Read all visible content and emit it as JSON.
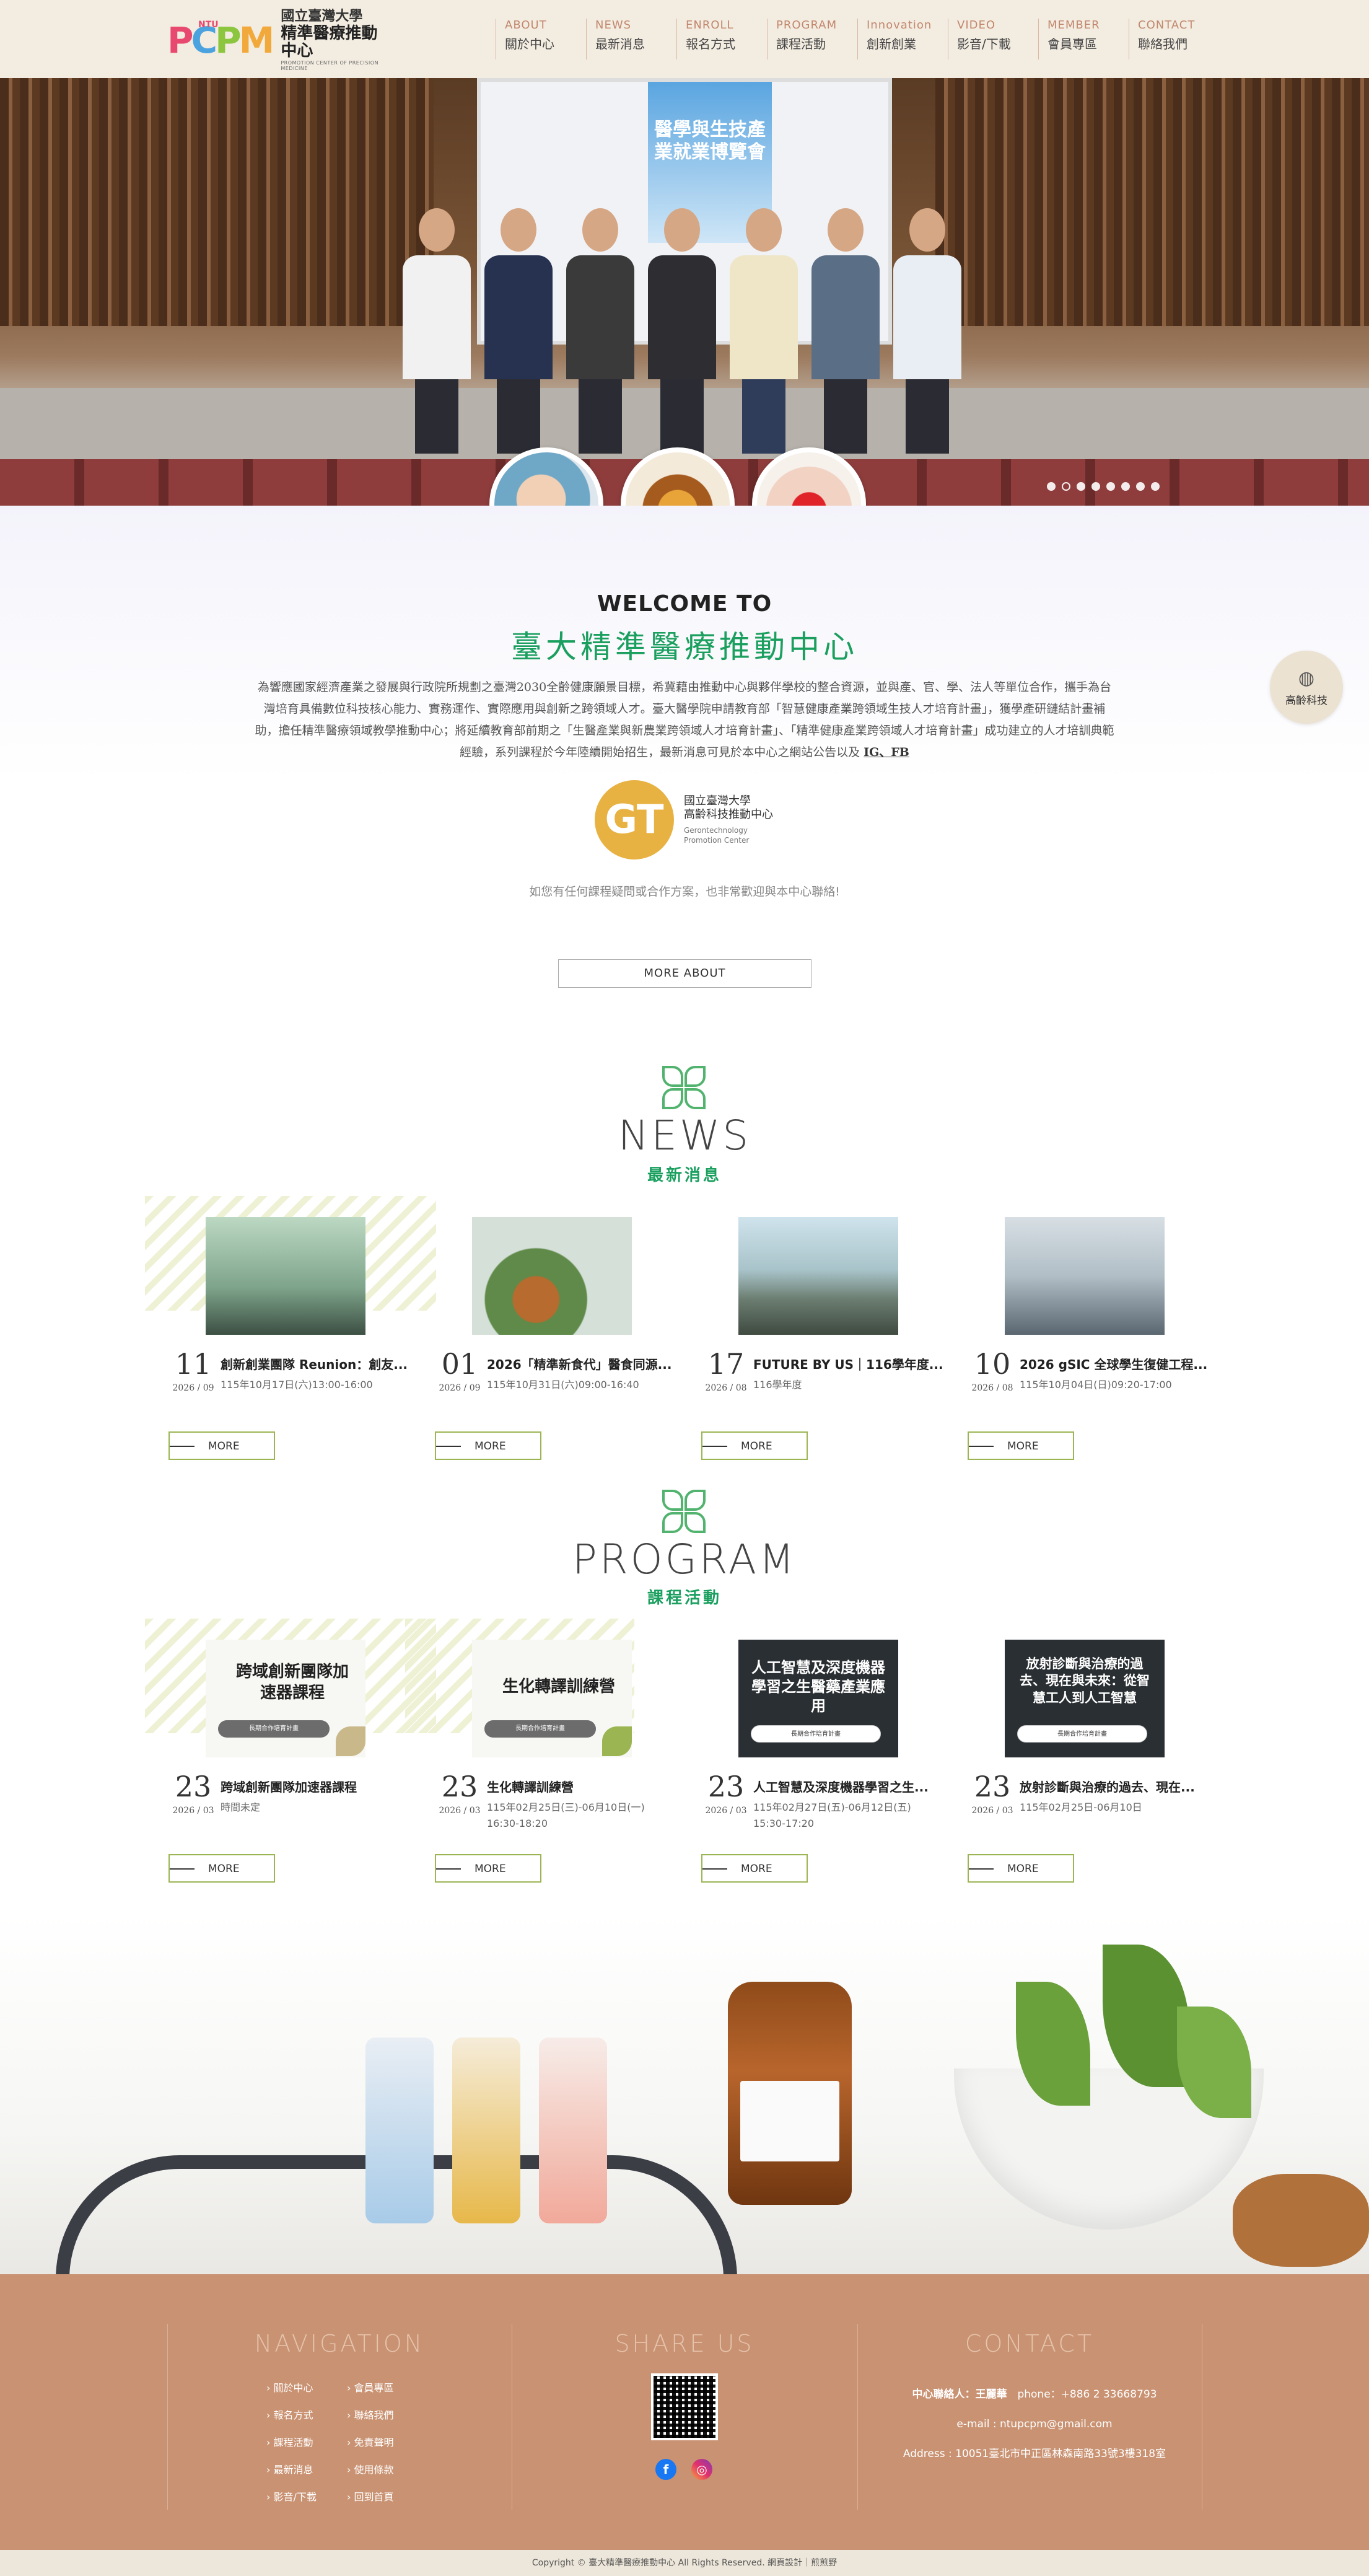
{
  "header": {
    "logo": {
      "badge": "NTU",
      "mark": "PCPM",
      "line1": "國立臺灣大學",
      "line2": "精準醫療推動中心",
      "line3": "PROMOTION CENTER OF PRECISION MEDICINE"
    },
    "nav": [
      {
        "en": "ABOUT",
        "zh": "關於中心"
      },
      {
        "en": "NEWS",
        "zh": "最新消息"
      },
      {
        "en": "ENROLL",
        "zh": "報名方式"
      },
      {
        "en": "PROGRAM",
        "zh": "課程活動"
      },
      {
        "en": "Innovation",
        "zh": "創新創業"
      },
      {
        "en": "VIDEO",
        "zh": "影音/下載"
      },
      {
        "en": "MEMBER",
        "zh": "會員專區"
      },
      {
        "en": "CONTACT",
        "zh": "聯絡我們"
      }
    ]
  },
  "hero": {
    "poster_title": "醫學與生技產業就業博覽會",
    "slides": 8,
    "active_slide": 2
  },
  "welcome": {
    "title_en": "WELCOME TO",
    "title_zh": "臺大精準醫療推動中心",
    "description": "為響應國家經濟產業之發展與行政院所規劃之臺灣2030全齡健康願景目標，希冀藉由推動中心與夥伴學校的整合資源，並與產、官、學、法人等單位合作，攜手為台灣培育具備數位科技核心能力、實務運作、實際應用與創新之跨領域人才。臺大醫學院申請教育部「智慧健康產業跨領域生技人才培育計畫」，獲學產研鏈結計畫補助，擔任精準醫療領域教學推動中心；將延續教育部前期之「生醫產業與新農業跨領域人才培育計畫」、「精準健康產業跨領域人才培育計畫」成功建立的人才培訓典範經驗，系列課程於今年陸續開始招生，最新消息可見於本中心之網站公告以及",
    "links": "IG、FB",
    "partner": {
      "mark": "GT",
      "line1": "國立臺灣大學",
      "line2": "高齡科技推動中心",
      "line3": "Gerontechnology",
      "line4": "Promotion Center"
    },
    "contact_note": "如您有任何課程疑問或合作方案，也非常歡迎與本中心聯絡!",
    "more_about": "MORE ABOUT"
  },
  "float": {
    "icon": "globe-icon",
    "label": "高齡科技"
  },
  "news": {
    "title": "NEWS",
    "subtitle": "最新消息",
    "items": [
      {
        "day": "11",
        "ym": "2026 / 09",
        "title": "創新創業團隊 Reunion：創友...",
        "meta": "115年10月17日(六)13:00-16:00",
        "more": "MORE"
      },
      {
        "day": "01",
        "ym": "2026 / 09",
        "title": "2026「精準新食代」醫食同源...",
        "meta": "115年10月31日(六)09:00-16:40",
        "more": "MORE"
      },
      {
        "day": "17",
        "ym": "2026 / 08",
        "title": "FUTURE BY US｜116學年度...",
        "meta": "116學年度",
        "more": "MORE"
      },
      {
        "day": "10",
        "ym": "2026 / 08",
        "title": "2026 gSIC 全球學生復健工程...",
        "meta": "115年10月04日(日)09:20-17:00",
        "more": "MORE"
      }
    ]
  },
  "program": {
    "title": "PROGRAM",
    "subtitle": "課程活動",
    "items": [
      {
        "day": "23",
        "ym": "2026 / 03",
        "img_title": "跨域創新團隊加速器課程",
        "img_bar": "長期合作培育計畫",
        "title": "跨域創新團隊加速器課程",
        "meta": "時間未定",
        "more": "MORE"
      },
      {
        "day": "23",
        "ym": "2026 / 03",
        "img_title": "生化轉譯訓練營",
        "img_bar": "長期合作培育計畫",
        "title": "生化轉譯訓練營",
        "meta": "115年02月25日(三)-06月10日(一) 16:30-18:20",
        "more": "MORE"
      },
      {
        "day": "23",
        "ym": "2026 / 03",
        "img_title": "人工智慧及深度機器學習之生醫藥產業應用",
        "img_bar": "長期合作培育計畫",
        "title": "人工智慧及深度機器學習之生...",
        "meta": "115年02月27日(五)-06月12日(五) 15:30-17:20",
        "more": "MORE"
      },
      {
        "day": "23",
        "ym": "2026 / 03",
        "img_title": "放射診斷與治療的過去、現在與未來：從智慧工人到人工智慧",
        "img_bar": "長期合作培育計畫",
        "title": "放射診斷與治療的過去、現在...",
        "meta": "115年02月25日-06月10日",
        "more": "MORE"
      }
    ]
  },
  "footer": {
    "nav_title": "NAVIGATION",
    "nav_items": [
      "關於中心",
      "會員專區",
      "報名方式",
      "聯絡我們",
      "課程活動",
      "免責聲明",
      "最新消息",
      "使用條款",
      "影音/下載",
      "回到首頁"
    ],
    "share_title": "SHARE US",
    "social": [
      {
        "icon": "facebook-icon",
        "label": "f"
      },
      {
        "icon": "instagram-icon",
        "label": "◎"
      }
    ],
    "contact_title": "CONTACT",
    "contact_person": "中心聯絡人：王麗華",
    "contact_phone": "phone：+886 2 33668793",
    "contact_email": "e-mail : ntupcpm@gmail.com",
    "contact_address": "Address : 10051臺北市中正區林森南路33號3樓318室"
  },
  "copyright": "Copyright © 臺大精準醫療推動中心 All Rights Reserved. 網頁設計｜煎煎野"
}
